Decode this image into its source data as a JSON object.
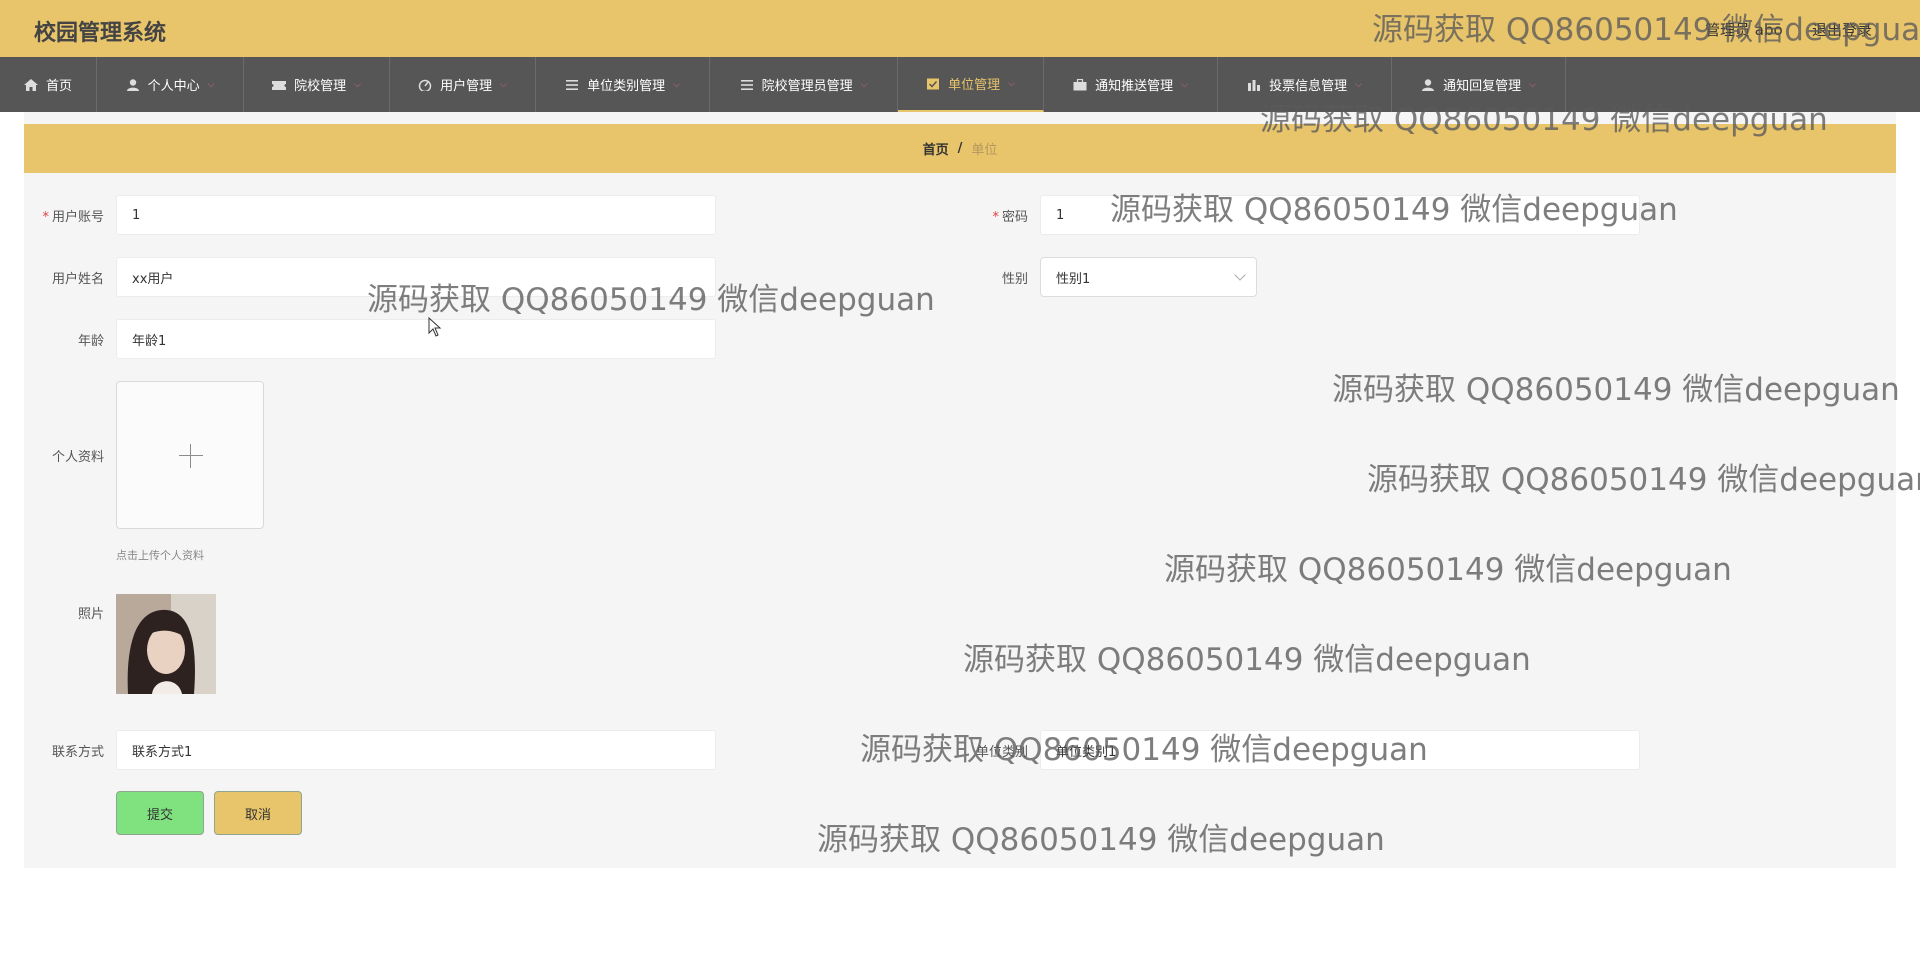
{
  "header": {
    "app_title": "校园管理系统",
    "user_info": "管理员 abo",
    "logout": "退出登录"
  },
  "nav": {
    "items": [
      {
        "label": "首页",
        "icon": "home-icon"
      },
      {
        "label": "个人中心",
        "icon": "user-icon"
      },
      {
        "label": "院校管理",
        "icon": "ticket-icon"
      },
      {
        "label": "用户管理",
        "icon": "gauge-icon"
      },
      {
        "label": "单位类别管理",
        "icon": "list-icon"
      },
      {
        "label": "院校管理员管理",
        "icon": "list-icon"
      },
      {
        "label": "单位管理",
        "icon": "check-square-icon"
      },
      {
        "label": "通知推送管理",
        "icon": "briefcase-icon"
      },
      {
        "label": "投票信息管理",
        "icon": "bar-chart-icon"
      },
      {
        "label": "通知回复管理",
        "icon": "user-icon"
      }
    ],
    "active_index": 6
  },
  "breadcrumb": {
    "home": "首页",
    "separator": "/",
    "current": "单位"
  },
  "form": {
    "account": {
      "label": "用户账号",
      "value": "1",
      "required": true
    },
    "password": {
      "label": "密码",
      "value": "1",
      "required": true
    },
    "name": {
      "label": "用户姓名",
      "value": "xx用户"
    },
    "gender": {
      "label": "性别",
      "value": "性别1"
    },
    "age": {
      "label": "年龄",
      "value": "年龄1"
    },
    "profile": {
      "label": "个人资料",
      "hint": "点击上传个人资料"
    },
    "photo": {
      "label": "照片"
    },
    "contact": {
      "label": "联系方式",
      "value": "联系方式1"
    },
    "unit_category": {
      "label": "单位类别",
      "value": "单位类别1"
    },
    "submit": "提交",
    "cancel": "取消",
    "required_mark": "*"
  },
  "watermark": "源码获取 QQ86050149 微信deepguan",
  "colors": {
    "header_bg": "#e8c46b",
    "nav_bg": "#565656",
    "submit_bg": "#80e27f",
    "cancel_bg": "#e8c46b"
  }
}
